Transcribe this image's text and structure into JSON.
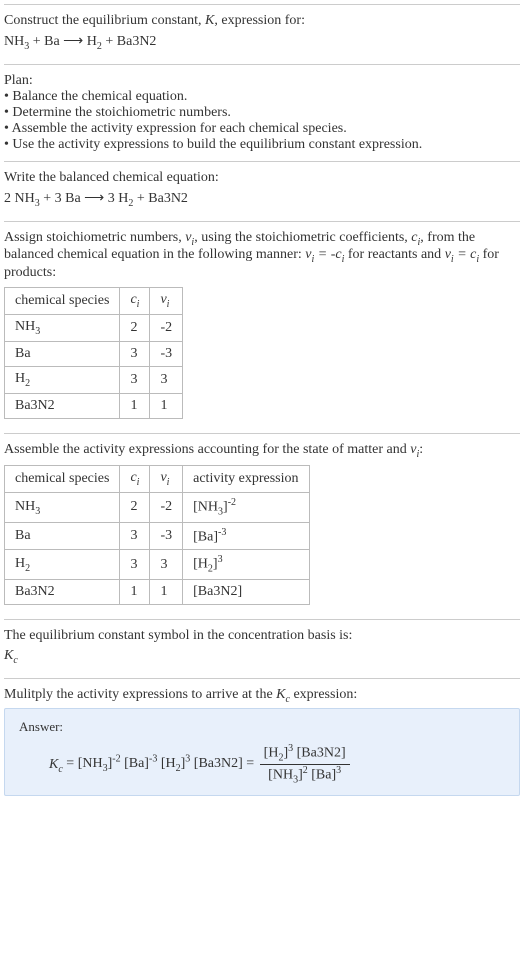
{
  "intro": {
    "line1_a": "Construct the equilibrium constant, ",
    "line1_b": ", expression for:",
    "eq_unbalanced": "NH₃ + Ba ⟶ H₂ + Ba3N2"
  },
  "plan": {
    "heading": "Plan:",
    "b1": "• Balance the chemical equation.",
    "b2": "• Determine the stoichiometric numbers.",
    "b3": "• Assemble the activity expression for each chemical species.",
    "b4": "• Use the activity expressions to build the equilibrium constant expression."
  },
  "balanced": {
    "heading": "Write the balanced chemical equation:",
    "eq": "2 NH₃ + 3 Ba ⟶ 3 H₂ + Ba3N2"
  },
  "stoich": {
    "text1": "Assign stoichiometric numbers, ",
    "text2": ", using the stoichiometric coefficients, ",
    "text3": ", from the balanced chemical equation in the following manner: ",
    "text4": " for reactants and ",
    "text5": " for products:",
    "h1": "chemical species",
    "r1c1": "NH₃",
    "r1c2": "2",
    "r1c3": "-2",
    "r2c1": "Ba",
    "r2c2": "3",
    "r2c3": "-3",
    "r3c1": "H₂",
    "r3c2": "3",
    "r3c3": "3",
    "r4c1": "Ba3N2",
    "r4c2": "1",
    "r4c3": "1"
  },
  "activity": {
    "text": "Assemble the activity expressions accounting for the state of matter and ",
    "h1": "chemical species",
    "h4": "activity expression",
    "r1c1": "NH₃",
    "r1c2": "2",
    "r1c3": "-2",
    "r2c1": "Ba",
    "r2c2": "3",
    "r2c3": "-3",
    "r3c1": "H₂",
    "r3c2": "3",
    "r3c3": "3",
    "r4c1": "Ba3N2",
    "r4c2": "1",
    "r4c3": "1",
    "r4c4": "[Ba3N2]"
  },
  "symbol": {
    "text": "The equilibrium constant symbol in the concentration basis is:"
  },
  "final": {
    "text": "Mulitply the activity expressions to arrive at the ",
    "text2": " expression:",
    "answer_label": "Answer:"
  }
}
